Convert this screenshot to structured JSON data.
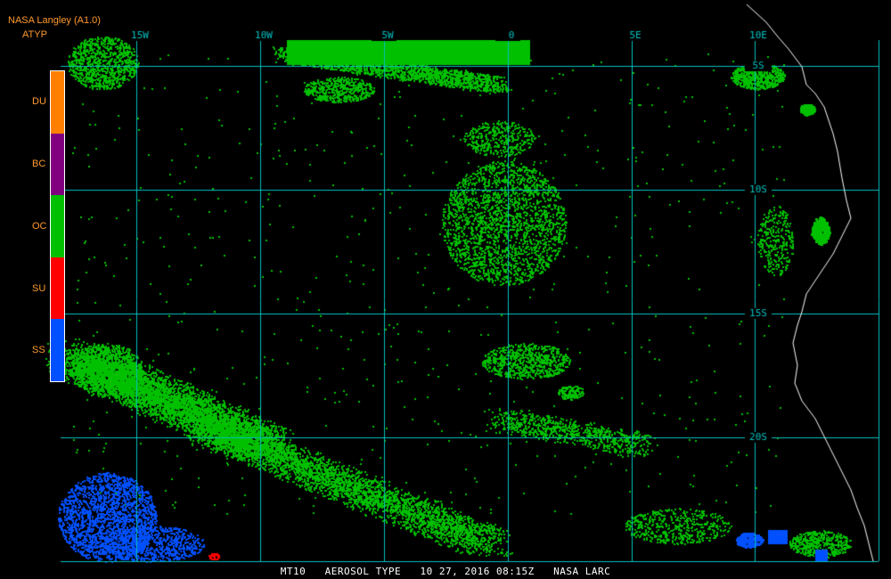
{
  "header": {
    "title": "NASA Langley (A1.0)",
    "product": "ATYP"
  },
  "legend": {
    "items": [
      {
        "label": "DU",
        "color": "#ff8000"
      },
      {
        "label": "BC",
        "color": "#800080"
      },
      {
        "label": "OC",
        "color": "#00c000"
      },
      {
        "label": "SU",
        "color": "#ff0000"
      },
      {
        "label": "SS",
        "color": "#0050ff"
      }
    ]
  },
  "map": {
    "lon_labels": [
      "15W",
      "10W",
      "5W",
      "0",
      "5E",
      "10E"
    ],
    "lat_labels": [
      "5S",
      "10S",
      "15S",
      "20S"
    ],
    "grid_color": "#00c0c0",
    "coast_color": "#ffffff",
    "land_color": "#000000",
    "ocean_color": "#000000",
    "no_data_color": "#000000"
  },
  "footer": {
    "instrument": "MT10",
    "product_name": "AEROSOL TYPE",
    "date": "10 27, 2016",
    "time": "08:15Z",
    "source": "NASA LARC"
  }
}
